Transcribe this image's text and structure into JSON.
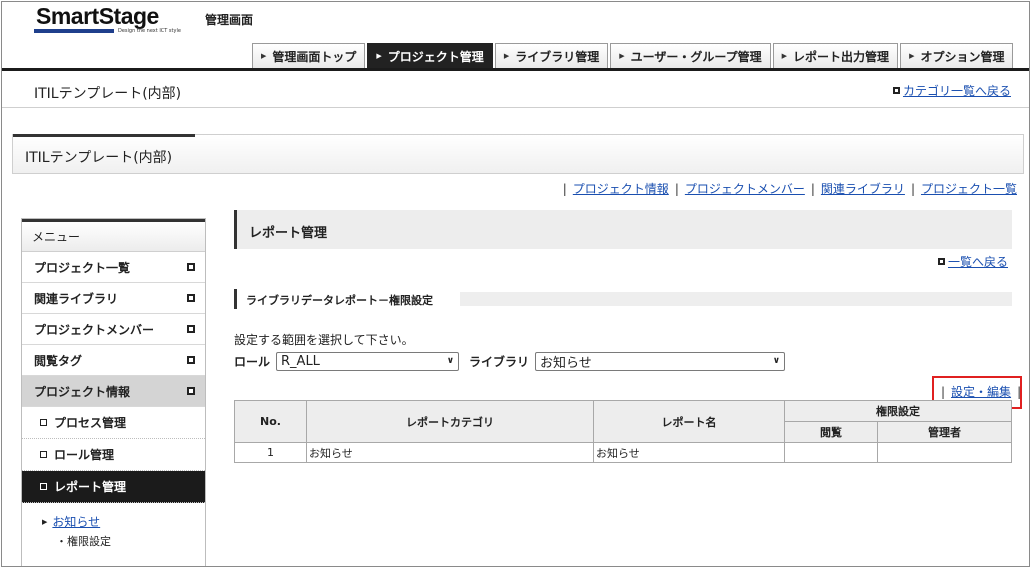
{
  "header": {
    "logo_text": "SmartStage",
    "logo_tagline": "Design the next ICT style",
    "admin_title": "管理画面",
    "nav": [
      {
        "label": "管理画面トップ",
        "active": false
      },
      {
        "label": "プロジェクト管理",
        "active": true
      },
      {
        "label": "ライブラリ管理",
        "active": false
      },
      {
        "label": "ユーザー・グループ管理",
        "active": false
      },
      {
        "label": "レポート出力管理",
        "active": false
      },
      {
        "label": "オプション管理",
        "active": false
      }
    ]
  },
  "subheader": {
    "title": "ITILテンプレート(内部)",
    "back_to_category": "カテゴリ一覧へ戻る"
  },
  "project": {
    "title": "ITILテンプレート(内部)",
    "links": [
      "プロジェクト情報",
      "プロジェクトメンバー",
      "関連ライブラリ",
      "プロジェクト一覧"
    ]
  },
  "sidebar": {
    "header": "メニュー",
    "items": [
      "プロジェクト一覧",
      "関連ライブラリ",
      "プロジェクトメンバー",
      "閲覧タグ",
      "プロジェクト情報"
    ],
    "subitems": [
      "プロセス管理",
      "ロール管理",
      "レポート管理"
    ],
    "tree": {
      "link": "お知らせ",
      "child": "・権限設定"
    }
  },
  "main": {
    "report_title": "レポート管理",
    "back_to_list": "一覧へ戻る",
    "section_title": "ライブラリデータレポート－権限設定",
    "instruction": "設定する範囲を選択して下さい。",
    "role_label": "ロール",
    "role_value": "R_ALL",
    "library_label": "ライブラリ",
    "library_value": "お知らせ",
    "settings_link": "設定・編集"
  },
  "table": {
    "headers": {
      "no": "No.",
      "category": "レポートカテゴリ",
      "name": "レポート名",
      "permission": "権限設定",
      "view": "閲覧",
      "admin": "管理者"
    },
    "rows": [
      {
        "no": "1",
        "category": "お知らせ",
        "name": "お知らせ",
        "view": "",
        "admin": ""
      }
    ]
  },
  "colors": {
    "accent_dark": "#1b1b1b",
    "link": "#1a4fb0",
    "highlight_box": "#e02020"
  }
}
